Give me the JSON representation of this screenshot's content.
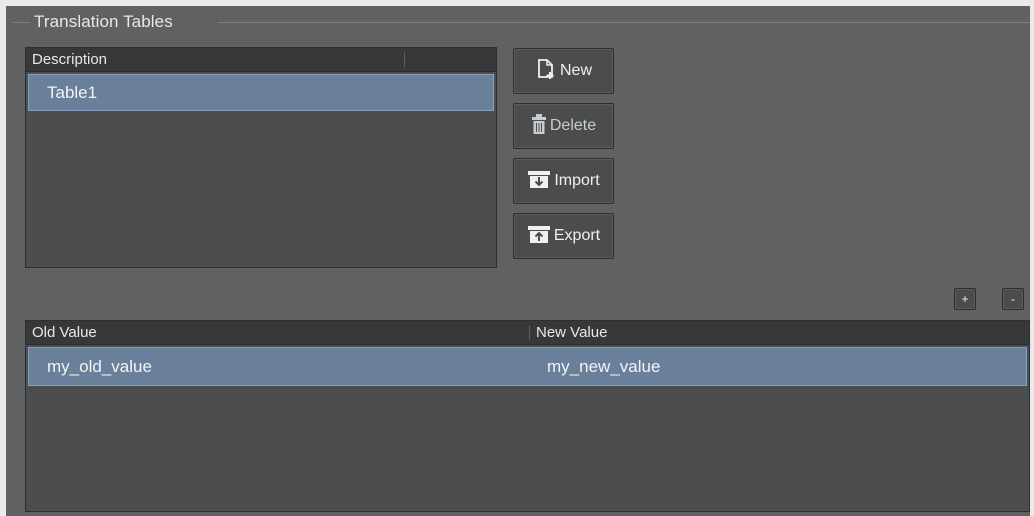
{
  "group": {
    "title": "Translation Tables"
  },
  "tables_list": {
    "header": "Description",
    "rows": [
      {
        "description": "Table1",
        "selected": true
      }
    ]
  },
  "buttons": {
    "new": {
      "label": "New",
      "icon": "new-document-icon"
    },
    "delete": {
      "label": "Delete",
      "icon": "trash-icon"
    },
    "import": {
      "label": "Import",
      "icon": "import-icon"
    },
    "export": {
      "label": "Export",
      "icon": "export-icon"
    }
  },
  "value_actions": {
    "add": "+",
    "remove": "-"
  },
  "values_table": {
    "columns": [
      "Old Value",
      "New Value"
    ],
    "rows": [
      {
        "old": "my_old_value",
        "new": "my_new_value",
        "selected": true
      }
    ]
  },
  "colors": {
    "selection": "#6a7f99",
    "background": "#5f6163",
    "header": "#36383a"
  }
}
